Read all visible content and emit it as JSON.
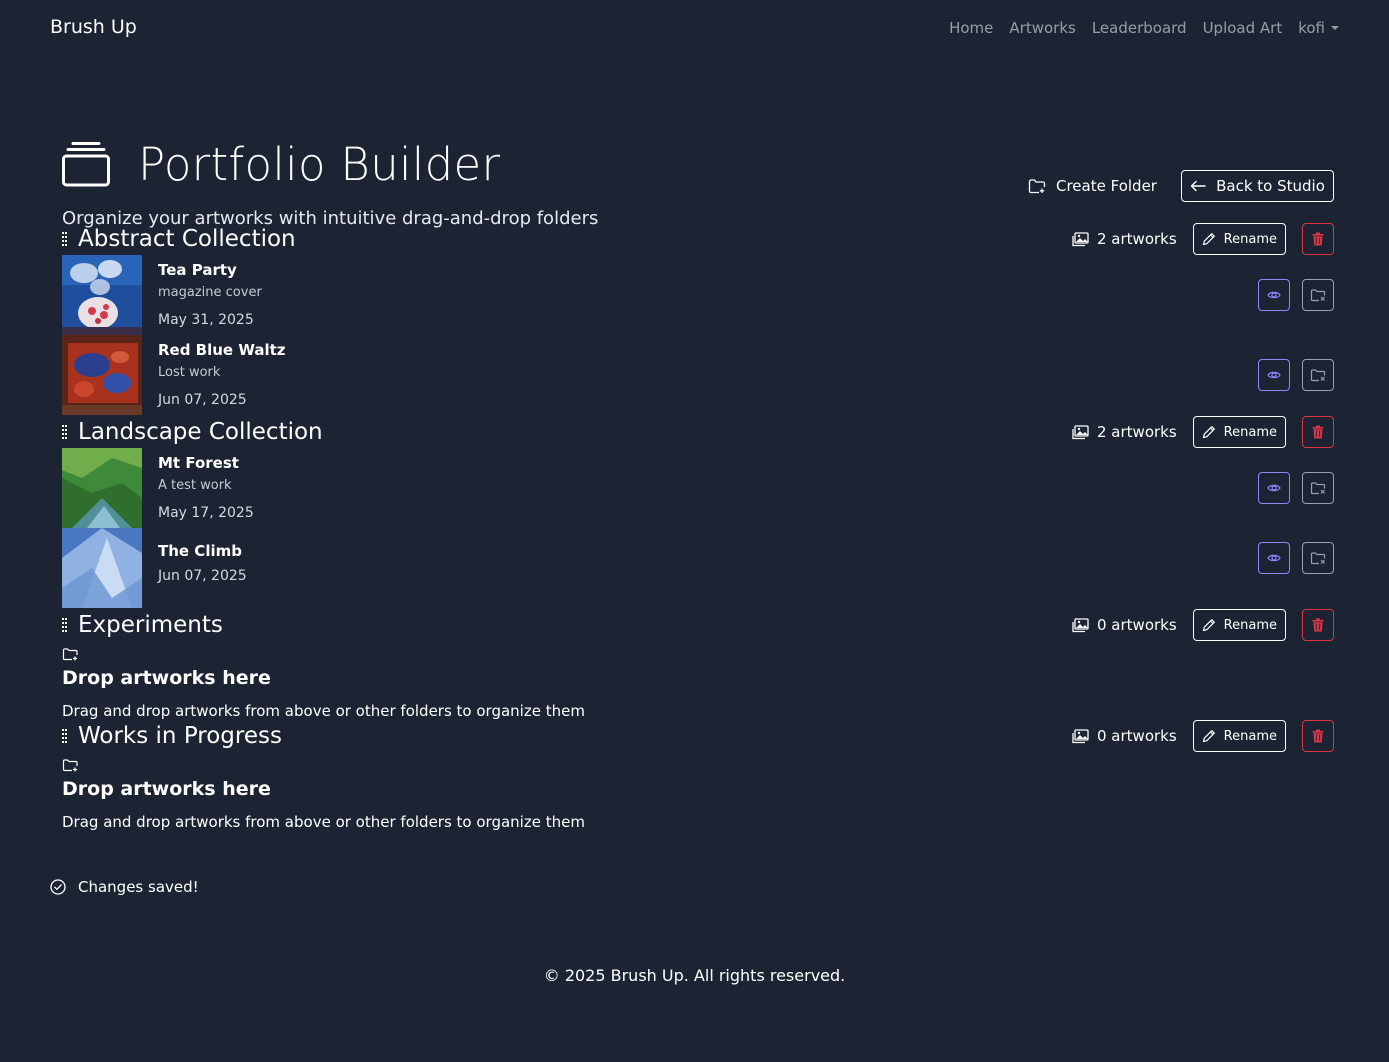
{
  "nav": {
    "brand": "Brush Up",
    "links": [
      "Home",
      "Artworks",
      "Leaderboard",
      "Upload Art"
    ],
    "user": "kofi"
  },
  "header": {
    "title": "Portfolio Builder",
    "subtitle": "Organize your artworks with intuitive drag-and-drop folders",
    "create_folder": "Create Folder",
    "back_to_studio": "Back to Studio"
  },
  "labels": {
    "rename": "Rename"
  },
  "folders": [
    {
      "name": "Abstract Collection",
      "count": "2 artworks",
      "artworks": [
        {
          "title": "Tea Party",
          "description": "magazine cover",
          "date": "May 31, 2025"
        },
        {
          "title": "Red Blue Waltz",
          "description": "Lost work",
          "date": "Jun 07, 2025"
        }
      ]
    },
    {
      "name": "Landscape Collection",
      "count": "2 artworks",
      "artworks": [
        {
          "title": "Mt Forest",
          "description": "A test work",
          "date": "May 17, 2025"
        },
        {
          "title": "The Climb",
          "description": "",
          "date": "Jun 07, 2025"
        }
      ]
    },
    {
      "name": "Experiments",
      "count": "0 artworks",
      "empty_title": "Drop artworks here",
      "empty_text": "Drag and drop artworks from above or other folders to organize them"
    },
    {
      "name": "Works in Progress",
      "count": "0 artworks",
      "empty_title": "Drop artworks here",
      "empty_text": "Drag and drop artworks from above or other folders to organize them"
    }
  ],
  "toast": "Changes saved!",
  "footer": "© 2025 Brush Up. All rights reserved.",
  "colors": {
    "background": "#1c2333",
    "accent_view": "#8b87ff",
    "danger": "#dc3545"
  }
}
